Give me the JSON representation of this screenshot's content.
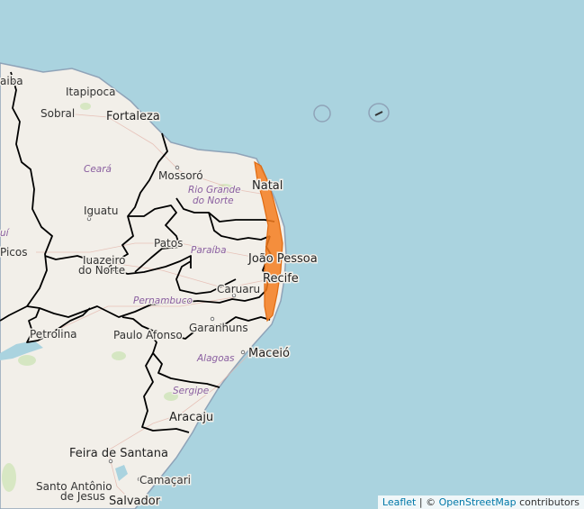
{
  "map": {
    "cities": {
      "fortaleza": "Fortaleza",
      "sobral": "Sobral",
      "itapipoca": "Itapipoca",
      "aiba": "aiba",
      "mossoro": "Mossoró",
      "natal": "Natal",
      "iguatu": "Iguatu",
      "patos": "Patos",
      "juazeiro_1": "Juazeiro",
      "juazeiro_2": "do Norte",
      "picos": "Picos",
      "joao_pessoa": "João Pessoa",
      "recife": "Recife",
      "caruaru": "Caruaru",
      "garanhuns": "Garanhuns",
      "petrolina": "Petrolina",
      "paulo_afonso": "Paulo Afonso",
      "maceio": "Maceió",
      "aracaju": "Aracaju",
      "feira": "Feira de Santana",
      "santo_antonio_1": "Santo Antônio",
      "santo_antonio_2": "de Jesus",
      "camacari": "Camaçari",
      "salvador": "Salvador"
    },
    "states": {
      "ceara": "Ceará",
      "rn_1": "Rio Grande",
      "rn_2": "do Norte",
      "paraiba": "Paraíba",
      "pernambuco": "Pernambuco",
      "alagoas": "Alagoas",
      "sergipe": "Sergipe",
      "piaui": "uí"
    },
    "alert_area_color": "#f57c1f",
    "colors": {
      "ocean": "#aad3df",
      "land": "#f2efe9",
      "border": "#000000"
    }
  },
  "attribution": {
    "leaflet": "Leaflet",
    "sep": " | © ",
    "osm": "OpenStreetMap",
    "contrib": " contributors"
  }
}
